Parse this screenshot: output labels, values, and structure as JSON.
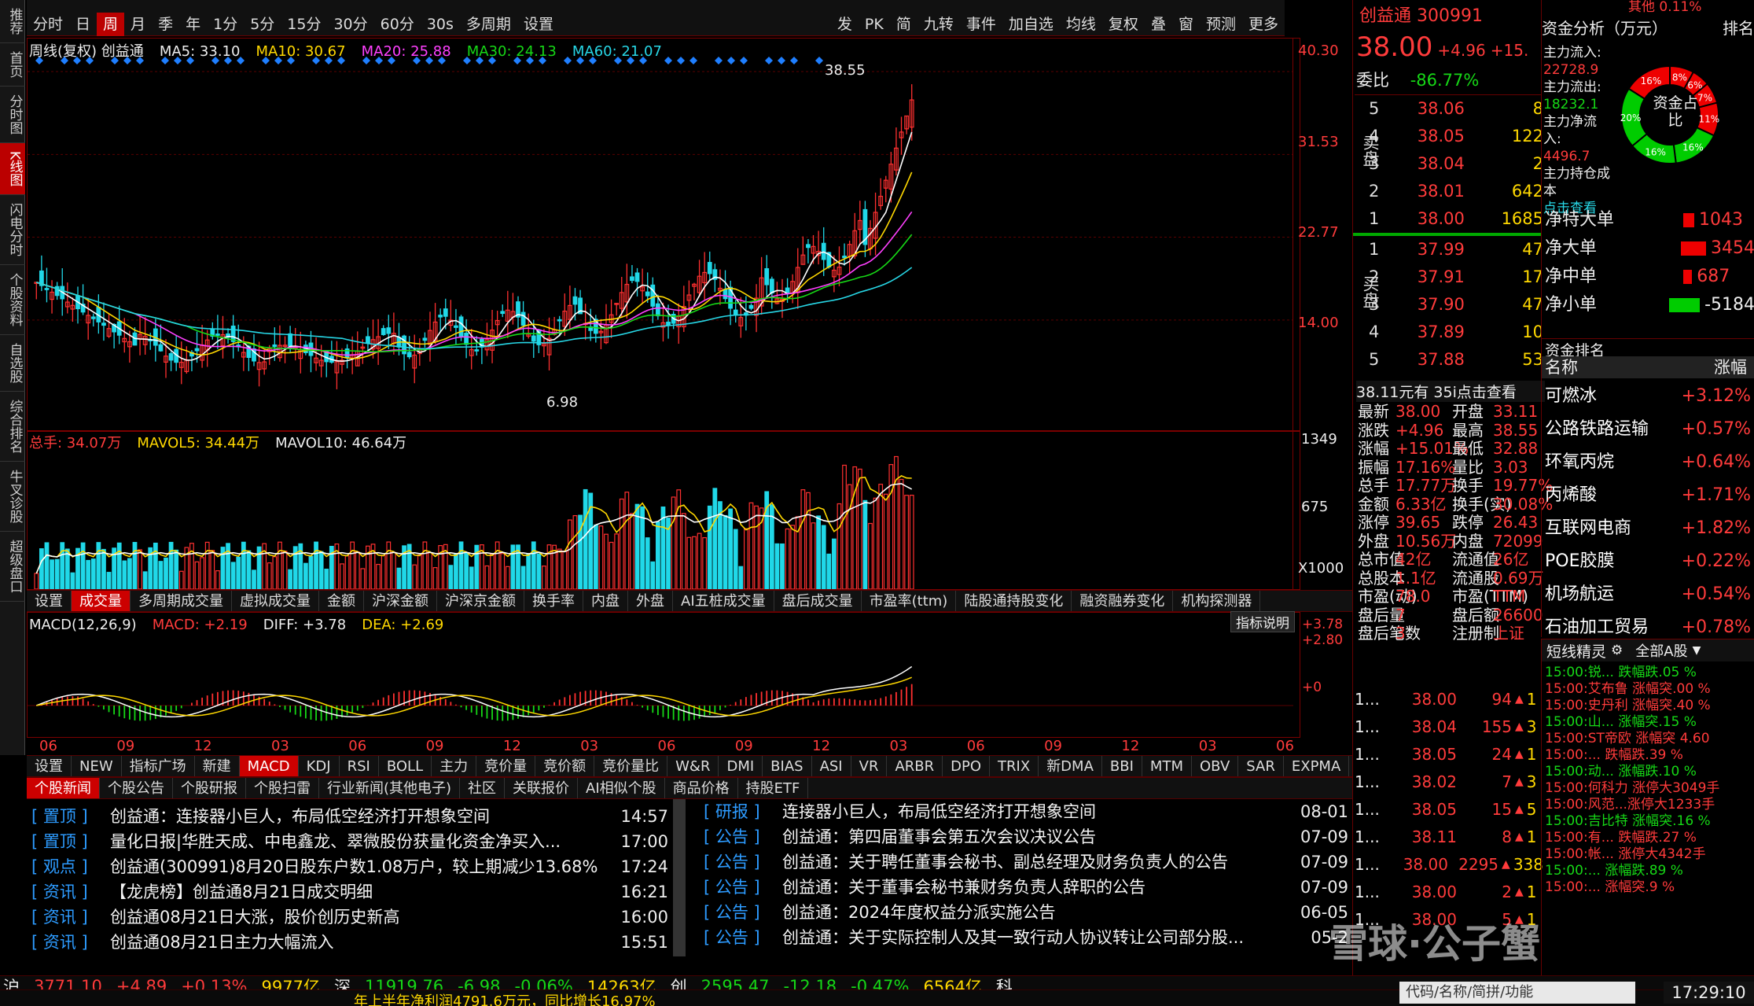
{
  "toolbar_top": {
    "items": [
      "分时",
      "日",
      "周",
      "月",
      "季",
      "年",
      "1分",
      "5分",
      "15分",
      "30分",
      "60分",
      "30s",
      "多周期",
      "设置"
    ],
    "active": "周",
    "right_items": [
      "发",
      "PK",
      "简",
      "九转",
      "事件",
      "加自选",
      "均线",
      "复权",
      "叠",
      "窗",
      "预测",
      "更多"
    ]
  },
  "left_nav": [
    "推荐",
    "首页",
    "分时图",
    "K线图",
    "闪电分时",
    "个股资料",
    "自选股",
    "综合排名",
    "牛叉诊股",
    "超级盘口"
  ],
  "kline": {
    "title": "周线(复权) 创益通",
    "ma5": "MA5: 33.10",
    "ma10": "MA10: 30.67",
    "ma20": "MA20: 25.88",
    "ma30": "MA30: 24.13",
    "ma60": "MA60: 21.07",
    "high_label": "38.55",
    "low_label": "6.98",
    "y_ticks": [
      "40.30",
      "31.53",
      "22.77",
      "14.00"
    ],
    "markers": [
      "L",
      "q",
      "q",
      "q",
      "L",
      "q"
    ]
  },
  "volume": {
    "label_total": "总手: 34.07万",
    "mavol5": "MAVOL5: 34.44万",
    "mavol10": "MAVOL10: 46.64万",
    "y_ticks": [
      "1349",
      "675",
      "X1000"
    ],
    "tabs": [
      "设置",
      "成交量",
      "多周期成交量",
      "虚拟成交量",
      "金额",
      "沪深金额",
      "沪深京金额",
      "换手率",
      "内盘",
      "外盘",
      "AI五桩成交量",
      "盘后成交量",
      "市盈率(ttm)",
      "陆股通持股变化",
      "融资融券变化",
      "机构探测器"
    ],
    "active_tab": "成交量"
  },
  "macd": {
    "params": "MACD(12,26,9)",
    "macd": "MACD: +2.19",
    "diff": "DIFF: +3.78",
    "dea": "DEA: +2.69",
    "y_ticks": [
      "+3.78",
      "+2.80",
      "+0"
    ],
    "help": "指标说明",
    "x_ticks": [
      "06",
      "09",
      "12",
      "03",
      "06",
      "09",
      "12",
      "03",
      "06",
      "09",
      "12",
      "03",
      "06",
      "09",
      "12",
      "03",
      "06"
    ]
  },
  "indicator_tabs": {
    "items": [
      "设置",
      "NEW",
      "指标广场",
      "新建",
      "MACD",
      "KDJ",
      "RSI",
      "BOLL",
      "主力",
      "竞价量",
      "竞价额",
      "竞价量比",
      "W&R",
      "DMI",
      "BIAS",
      "ASI",
      "VR",
      "ARBR",
      "DPO",
      "TRIX",
      "新DMA",
      "BBI",
      "MTM",
      "OBV",
      "SAR",
      "EXPMA"
    ],
    "active": "MACD"
  },
  "news_tabs": {
    "items": [
      "个股新闻",
      "个股公告",
      "个股研报",
      "个股扫雷",
      "行业新闻(其他电子)",
      "社区",
      "关联报价",
      "AI相似个股",
      "商品价格",
      "持股ETF"
    ],
    "active": "个股新闻"
  },
  "news_left": [
    {
      "tag": "[ 置顶 ]",
      "title": "创益通：连接器小巨人，布局低空经济打开想象空间",
      "time": "14:57"
    },
    {
      "tag": "[ 置顶 ]",
      "title": "量化日报|华胜天成、中电鑫龙、翠微股份获量化资金净买入...",
      "time": "17:00"
    },
    {
      "tag": "[ 观点 ]",
      "title": "创益通(300991)8月20日股东户数1.08万户，较上期减少13.68%",
      "time": "17:24"
    },
    {
      "tag": "[ 资讯 ]",
      "title": "【龙虎榜】创益通8月21日成交明细",
      "time": "16:21"
    },
    {
      "tag": "[ 资讯 ]",
      "title": "创益通08月21日大涨，股价创历史新高",
      "time": "16:00"
    },
    {
      "tag": "[ 资讯 ]",
      "title": "创益通08月21日主力大幅流入",
      "time": "15:51"
    }
  ],
  "news_right": [
    {
      "tag": "[ 研报 ]",
      "title": "连接器小巨人，布局低空经济打开想象空间",
      "time": "08-01"
    },
    {
      "tag": "[ 公告 ]",
      "title": "创益通：第四届董事会第五次会议决议公告",
      "time": "07-09"
    },
    {
      "tag": "[ 公告 ]",
      "title": "创益通：关于聘任董事会秘书、副总经理及财务负责人的公告",
      "time": "07-09"
    },
    {
      "tag": "[ 公告 ]",
      "title": "创益通：关于董事会秘书兼财务负责人辞职的公告",
      "time": "07-09"
    },
    {
      "tag": "[ 公告 ]",
      "title": "创益通：2024年度权益分派实施公告",
      "time": "06-05"
    },
    {
      "tag": "[ 公告 ]",
      "title": "创益通：关于实际控制人及其一致行动人协议转让公司部分股...",
      "time": "05-2"
    }
  ],
  "quote": {
    "name": "创益通 300991",
    "price": "38.00",
    "change": "+4.96",
    "pct": "+15.",
    "weibi_label": "委比",
    "weibi": "-86.77%",
    "sell_label": "卖盘",
    "buy_label": "买盘",
    "asks": [
      {
        "n": "5",
        "p": "38.06",
        "v": "8"
      },
      {
        "n": "4",
        "p": "38.05",
        "v": "122"
      },
      {
        "n": "3",
        "p": "38.04",
        "v": "2"
      },
      {
        "n": "2",
        "p": "38.01",
        "v": "642"
      },
      {
        "n": "1",
        "p": "38.00",
        "v": "1685"
      }
    ],
    "bids": [
      {
        "n": "1",
        "p": "37.99",
        "v": "47"
      },
      {
        "n": "2",
        "p": "37.91",
        "v": "17"
      },
      {
        "n": "3",
        "p": "37.90",
        "v": "47"
      },
      {
        "n": "4",
        "p": "37.89",
        "v": "10"
      },
      {
        "n": "5",
        "p": "37.88",
        "v": "53"
      }
    ],
    "l2_banner": "38.11元有 35i点击查看",
    "stats": [
      [
        "最新",
        "38.00",
        "开盘",
        "33.11"
      ],
      [
        "涨跌",
        "+4.96",
        "最高",
        "38.55"
      ],
      [
        "涨幅",
        "+15.01%",
        "最低",
        "32.88"
      ],
      [
        "振幅",
        "17.16%",
        "量比",
        "3.03"
      ],
      [
        "总手",
        "17.77万",
        "换手",
        "19.77%"
      ],
      [
        "金额",
        "6.33亿",
        "换手(实)",
        "30.08%"
      ],
      [
        "涨停",
        "39.65",
        "跌停",
        "26.43"
      ],
      [
        "外盘",
        "10.56万",
        "内盘",
        "72099"
      ],
      [
        "总市值",
        "42亿",
        "流通值",
        "26亿"
      ],
      [
        "总股本",
        "1.1亿",
        "流通股",
        "0.69万"
      ],
      [
        "市盈(动)",
        "78.0",
        "市盈(TTM)",
        "TTM"
      ],
      [
        "盘后量",
        "7",
        "盘后额",
        "26600"
      ],
      [
        "盘后笔数",
        "3",
        "注册制",
        "上证"
      ]
    ],
    "ticks": [
      {
        "t": "1...",
        "p": "38.00",
        "v": "94",
        "d": "1"
      },
      {
        "t": "1...",
        "p": "38.04",
        "v": "155",
        "d": "3"
      },
      {
        "t": "1...",
        "p": "38.05",
        "v": "24",
        "d": "1"
      },
      {
        "t": "1...",
        "p": "38.02",
        "v": "7",
        "d": "3"
      },
      {
        "t": "1...",
        "p": "38.05",
        "v": "15",
        "d": "5"
      },
      {
        "t": "1...",
        "p": "38.11",
        "v": "8",
        "d": "1"
      },
      {
        "t": "1...",
        "p": "38.00",
        "v": "2295",
        "d": "338"
      },
      {
        "t": "1...",
        "p": "38.00",
        "v": "2",
        "d": "1"
      },
      {
        "t": "1...",
        "p": "38.00",
        "v": "5",
        "d": "1"
      }
    ]
  },
  "fund": {
    "title": "资金分析（万元）",
    "rank_link": "排名",
    "other": "其他 0.11%",
    "inflow_label": "主力流入:",
    "inflow": "22728.9",
    "outflow_label": "主力流出:",
    "outflow": "18232.1",
    "net_label": "主力净流入:",
    "net": "4496.7",
    "cost_label": "主力持仓成本",
    "check": "点击查看",
    "donut_center": "资金占比",
    "donut_labels": [
      "8%",
      "6%",
      "7%",
      "11%",
      "16%",
      "16%",
      "20%",
      "16%"
    ],
    "items": [
      {
        "label": "净特大单",
        "value": "1043",
        "pos": true
      },
      {
        "label": "净大单",
        "value": "3454",
        "pos": true
      },
      {
        "label": "净中单",
        "value": "687",
        "pos": true
      },
      {
        "label": "净小单",
        "value": "-5184",
        "pos": false
      }
    ]
  },
  "rank": {
    "title": "资金排名",
    "col_name": "名称",
    "col_pct": "涨幅",
    "items": [
      {
        "name": "可燃冰",
        "pct": "+3.12%"
      },
      {
        "name": "公路铁路运输",
        "pct": "+0.57%"
      },
      {
        "name": "环氧丙烷",
        "pct": "+0.64%"
      },
      {
        "name": "丙烯酸",
        "pct": "+1.71%"
      },
      {
        "name": "互联网电商",
        "pct": "+1.82%"
      },
      {
        "name": "POE胶膜",
        "pct": "+0.22%"
      },
      {
        "name": "机场航运",
        "pct": "+0.54%"
      },
      {
        "name": "石油加工贸易",
        "pct": "+0.78%"
      }
    ]
  },
  "short_wizard": {
    "title": "短线精灵",
    "scope": "全部A股",
    "items": [
      "15:00:锐...  跌幅跌.05 %",
      "15:00:艾布鲁 涨幅突.00 %",
      "15:00:史丹利 涨幅突.40 %",
      "15:00:山...  涨幅突.15 %",
      "15:00:ST帝欧 涨幅突 4.60",
      "15:00:...    跌幅跌.39 %",
      "15:00:动...  涨幅跌.10 %",
      "15:00:何科力 涨停大3049手",
      "15:00:风范...涨停大1233手",
      "15:00:吉比特 涨幅突.16 %",
      "15:00:有...  跌幅跌.27 %",
      "15:00:帐...  涨停大4342手",
      "15:00:...    涨幅跌.89 %",
      "15:00:...    涨幅突.9 %"
    ]
  },
  "statusbar": {
    "sh_label": "沪",
    "sh": "3771.10",
    "sh_chg": "+4.89",
    "sh_pct": "+0.13%",
    "sh_amt": "9977亿",
    "sz_label": "深",
    "sz": "11919.76",
    "sz_chg": "-6.98",
    "sz_pct": "-0.06%",
    "sz_amt": "14263亿",
    "cy_label": "创",
    "cy": "2595.47",
    "cy_chg": "-12.18",
    "cy_pct": "-0.47%",
    "cy_amt": "6564亿",
    "ke_label": "科",
    "search_placeholder": "代码/名称/简拼/功能",
    "clock": "17:29:10",
    "ticker": "年上半年净利润4791.6万元，同比增长16.97%"
  },
  "watermark": "雪球·公子蟹"
}
